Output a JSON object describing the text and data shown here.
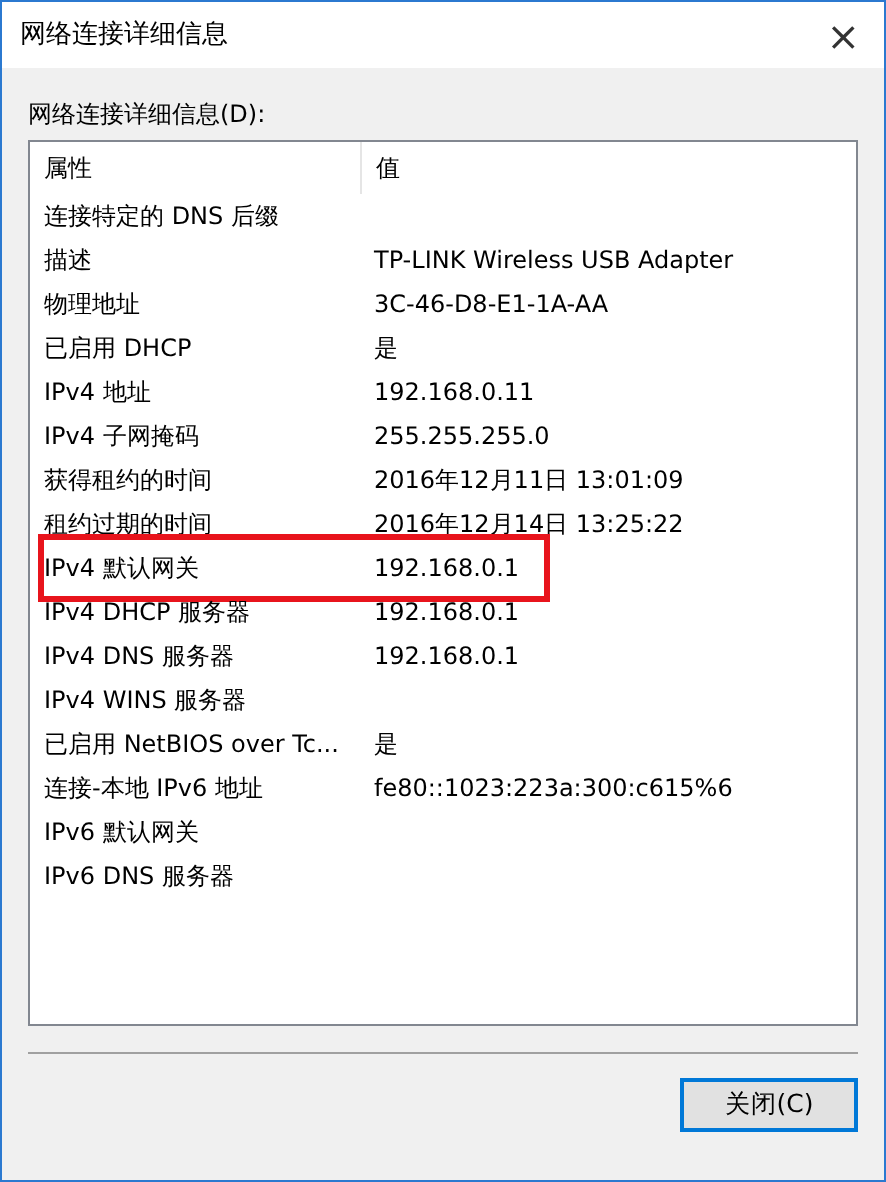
{
  "window": {
    "title": "网络连接详细信息",
    "close": "×"
  },
  "list_label": "网络连接详细信息(D):",
  "table": {
    "columns": [
      "属性",
      "值"
    ],
    "rows": [
      {
        "property": "连接特定的 DNS 后缀",
        "value": "",
        "highlighted": false
      },
      {
        "property": "描述",
        "value": "TP-LINK Wireless USB Adapter",
        "highlighted": false
      },
      {
        "property": "物理地址",
        "value": "3C-46-D8-E1-1A-AA",
        "highlighted": false
      },
      {
        "property": "已启用 DHCP",
        "value": "是",
        "highlighted": false
      },
      {
        "property": "IPv4 地址",
        "value": "192.168.0.11",
        "highlighted": false
      },
      {
        "property": "IPv4 子网掩码",
        "value": "255.255.255.0",
        "highlighted": false
      },
      {
        "property": "获得租约的时间",
        "value": "2016年12月11日 13:01:09",
        "highlighted": false
      },
      {
        "property": "租约过期的时间",
        "value": "2016年12月14日 13:25:22",
        "highlighted": false
      },
      {
        "property": "IPv4 默认网关",
        "value": "192.168.0.1",
        "highlighted": true
      },
      {
        "property": "IPv4 DHCP 服务器",
        "value": "192.168.0.1",
        "highlighted": false
      },
      {
        "property": "IPv4 DNS 服务器",
        "value": "192.168.0.1",
        "highlighted": false
      },
      {
        "property": "IPv4 WINS 服务器",
        "value": "",
        "highlighted": false
      },
      {
        "property": "已启用 NetBIOS over Tc...",
        "value": "是",
        "highlighted": false
      },
      {
        "property": "连接-本地 IPv6 地址",
        "value": "fe80::1023:223a:300:c615%6",
        "highlighted": false
      },
      {
        "property": "IPv6 默认网关",
        "value": "",
        "highlighted": false
      },
      {
        "property": "IPv6 DNS 服务器",
        "value": "",
        "highlighted": false
      }
    ]
  },
  "buttons": [
    {
      "label": "关闭(C)",
      "focused": true
    }
  ]
}
